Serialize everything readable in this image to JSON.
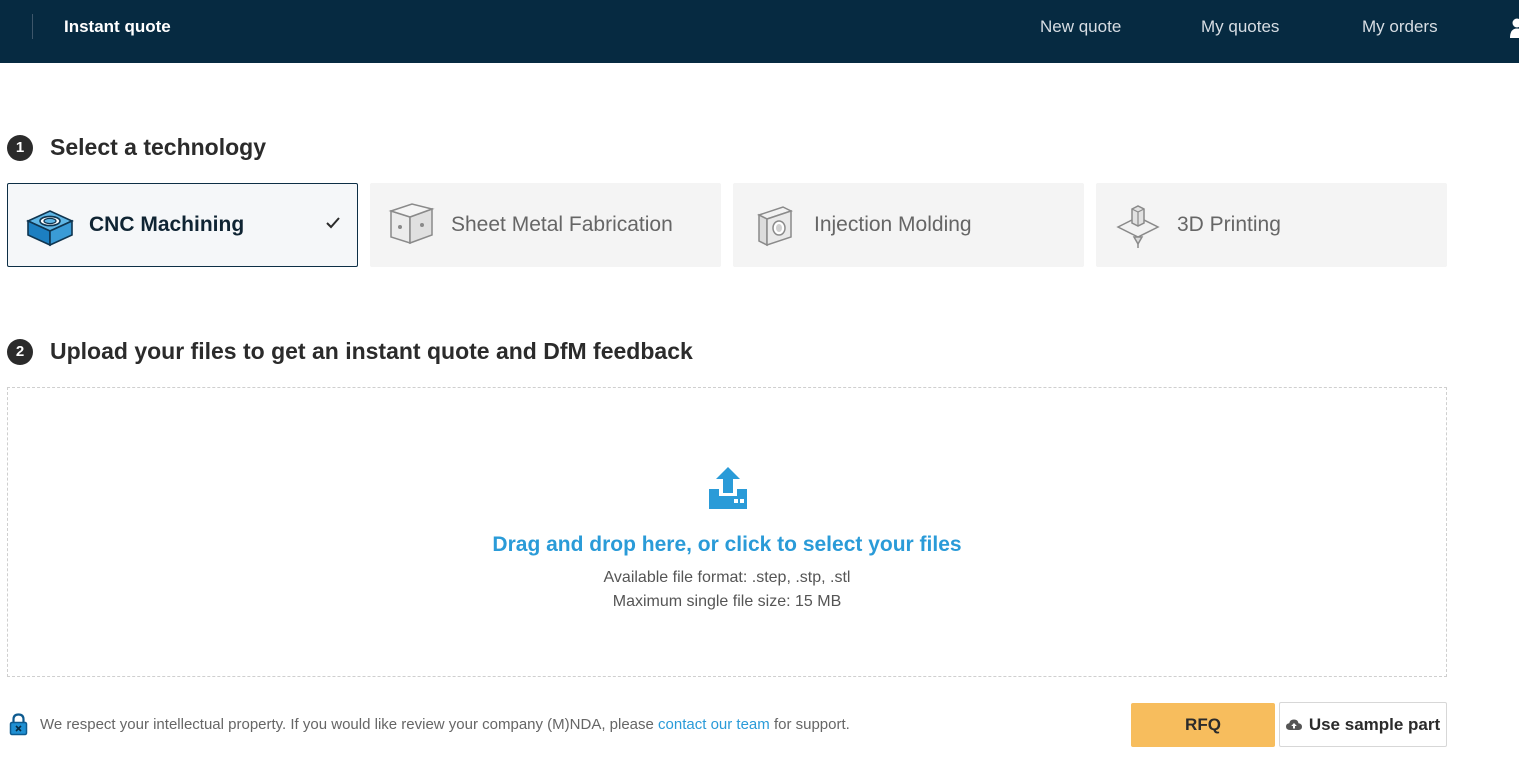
{
  "nav": {
    "brand": "Instant quote",
    "links": [
      "New quote",
      "My quotes",
      "My orders"
    ],
    "user_icon": "user-icon"
  },
  "steps": [
    {
      "number": "1",
      "title": "Select a technology"
    },
    {
      "number": "2",
      "title": "Upload your files to get an instant quote and DfM feedback"
    }
  ],
  "technologies": [
    {
      "label": "CNC Machining",
      "icon": "cnc-machining-icon",
      "selected": true
    },
    {
      "label": "Sheet Metal Fabrication",
      "icon": "sheet-metal-icon",
      "selected": false
    },
    {
      "label": "Injection Molding",
      "icon": "injection-molding-icon",
      "selected": false
    },
    {
      "label": "3D Printing",
      "icon": "3d-printing-icon",
      "selected": false
    }
  ],
  "upload": {
    "cta": "Drag and drop here, or click to select your files",
    "formats": "Available file format: .step, .stp, .stl",
    "max_size": "Maximum single file size: 15 MB",
    "icon": "upload-icon"
  },
  "footer": {
    "ip_note_before": "We respect your intellectual property. If you would like review your company (M)NDA, please ",
    "ip_note_link": "contact our team",
    "ip_note_after": " for support.",
    "rfq_label": "RFQ",
    "sample_label": "Use sample part"
  },
  "colors": {
    "nav_bg": "#062a41",
    "accent_blue": "#2a9bd8",
    "rfq_orange": "#f7bd5d"
  }
}
